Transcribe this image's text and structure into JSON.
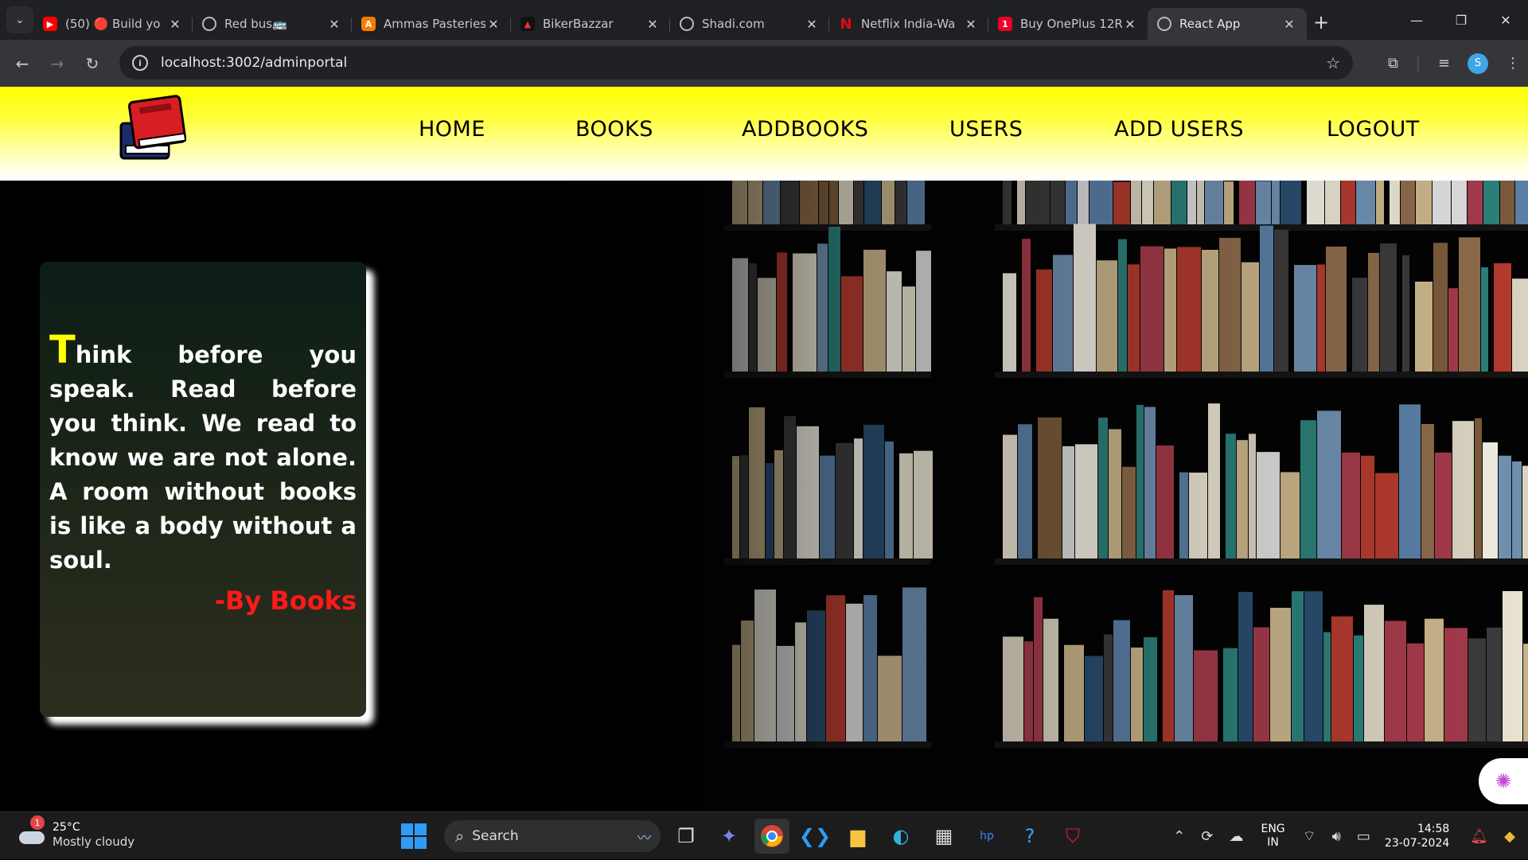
{
  "browser": {
    "tabs": [
      {
        "title": "(50) 🔴 Build yo",
        "favicon_color": "#ff0000",
        "favicon_icon": "youtube-icon"
      },
      {
        "title": "Red bus🚌",
        "favicon_color": "#5f6368",
        "favicon_icon": "globe-icon"
      },
      {
        "title": "Ammas Pasteries",
        "favicon_color": "#f57c00",
        "favicon_icon": "ammas-icon"
      },
      {
        "title": "BikerBazzar",
        "favicon_color": "#111111",
        "favicon_icon": "bikerbazzar-icon"
      },
      {
        "title": "Shadi.com",
        "favicon_color": "#5f6368",
        "favicon_icon": "globe-icon"
      },
      {
        "title": "Netflix India-Wa",
        "favicon_color": "#e50914",
        "favicon_icon": "netflix-icon"
      },
      {
        "title": "Buy OnePlus 12R",
        "favicon_color": "#eb0028",
        "favicon_icon": "oneplus-icon"
      },
      {
        "title": "React App",
        "favicon_color": "#5f6368",
        "favicon_icon": "globe-icon",
        "active": true
      }
    ],
    "url": "localhost:3002/adminportal",
    "profile_initial": "S"
  },
  "site": {
    "nav": [
      "HOME",
      "BOOKS",
      "ADDBOOKS",
      "USERS",
      "ADD USERS",
      "LOGOUT"
    ],
    "quote": {
      "first_letter": "T",
      "rest": "hink before you speak. Read before you think. We read to know we are not alone. A room without books is like a body without a soul.",
      "by": "-By Books"
    },
    "colors": {
      "header_yellow": "#ffff00",
      "quote_first_letter": "#ffff00",
      "quote_by": "#ff1a1a"
    }
  },
  "taskbar": {
    "weather": {
      "temp": "25°C",
      "condition": "Mostly cloudy",
      "badge": "1"
    },
    "search_placeholder": "Search",
    "lang": [
      "ENG",
      "IN"
    ],
    "time": "14:58",
    "date": "23-07-2024"
  }
}
